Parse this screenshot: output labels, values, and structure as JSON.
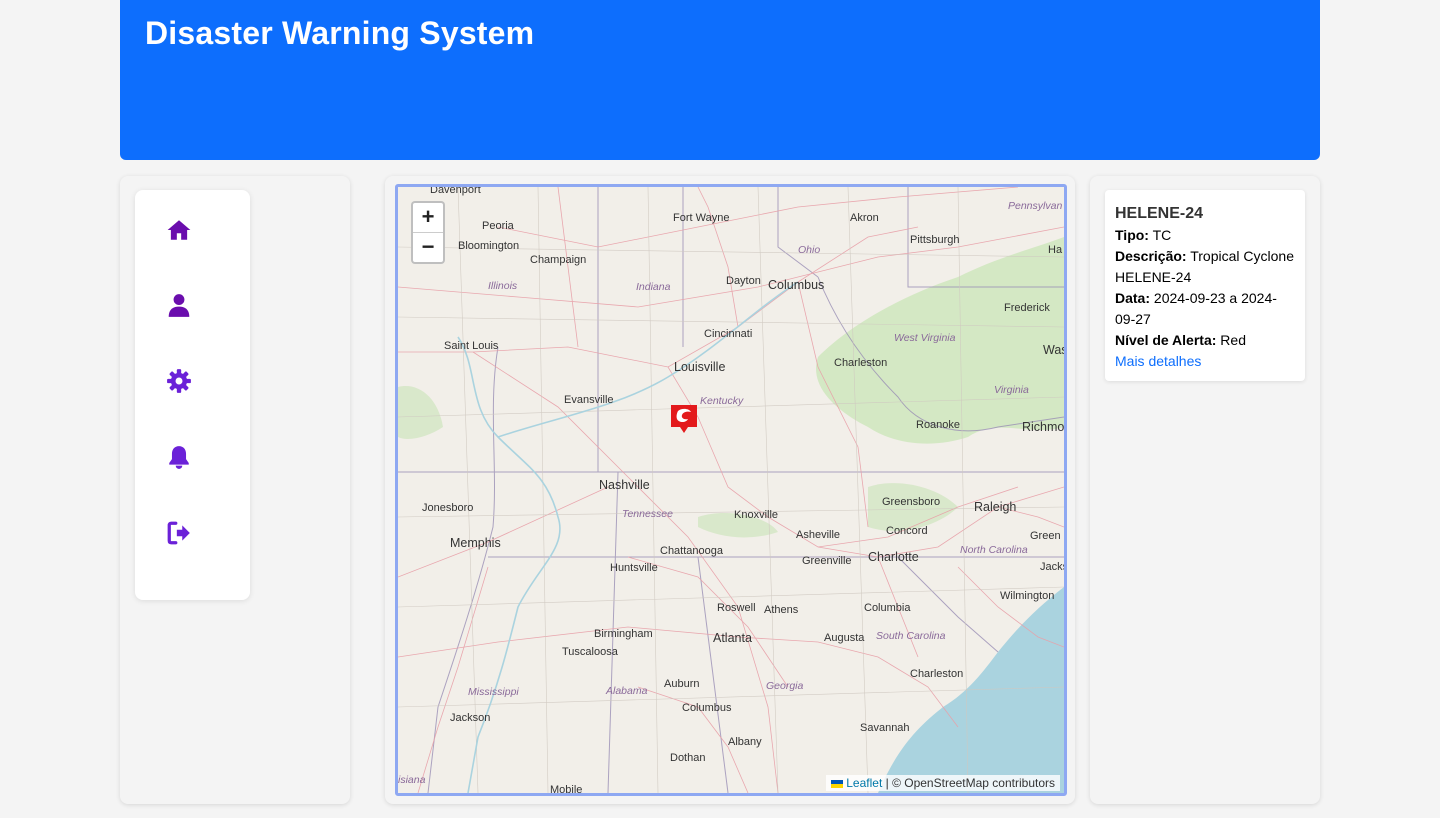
{
  "header": {
    "title": "Disaster Warning System"
  },
  "nav": {
    "items": [
      {
        "name": "home",
        "icon": "home-icon",
        "color": "#6a0dad"
      },
      {
        "name": "profile",
        "icon": "user-icon",
        "color": "#6a0dad"
      },
      {
        "name": "settings",
        "icon": "gear-icon",
        "color": "#6b21d8"
      },
      {
        "name": "notifications",
        "icon": "bell-icon",
        "color": "#6b21d8"
      },
      {
        "name": "logout",
        "icon": "logout-icon",
        "color": "#6b21d8"
      }
    ]
  },
  "map": {
    "zoom_in": "+",
    "zoom_out": "−",
    "attribution_link": "Leaflet",
    "attribution_text": "| © OpenStreetMap contributors",
    "marker_icon": "cyclone-icon",
    "cities": [
      "Davenport",
      "Peoria",
      "Bloomington",
      "Champaign",
      "Fort Wayne",
      "Akron",
      "Pittsburgh",
      "Dayton",
      "Columbus",
      "Cincinnati",
      "Saint Louis",
      "Louisville",
      "Evansville",
      "Charleston",
      "Frederick",
      "Wash",
      "Roanoke",
      "Richmo",
      "Nashville",
      "Jonesboro",
      "Memphis",
      "Knoxville",
      "Asheville",
      "Greensboro",
      "Raleigh",
      "Concord",
      "Charlotte",
      "Greenville",
      "Chattanooga",
      "Huntsville",
      "Roswell",
      "Athens",
      "Columbia",
      "Wilmington",
      "Jackson",
      "Birmingham",
      "Atlanta",
      "Augusta",
      "Tuscaloosa",
      "Charleston",
      "Auburn",
      "Columbus",
      "Albany",
      "Savannah",
      "Dothan",
      "Jackson",
      "Mobile",
      "Ha",
      "Green"
    ],
    "states": [
      "Illinois",
      "Indiana",
      "Ohio",
      "Pennsylvan",
      "West Virginia",
      "Virginia",
      "Kentucky",
      "Tennessee",
      "North Carolina",
      "South Carolina",
      "Mississippi",
      "Alabama",
      "Georgia",
      "isiana"
    ]
  },
  "info": {
    "title": "HELENE-24",
    "tipo_label": "Tipo:",
    "tipo_value": "TC",
    "descricao_label": "Descrição:",
    "descricao_value": "Tropical Cyclone HELENE-24",
    "data_label": "Data:",
    "data_value": "2024-09-23 a 2024-09-27",
    "nivel_label": "Nível de Alerta:",
    "nivel_value": "Red",
    "link": "Mais detalhes"
  }
}
